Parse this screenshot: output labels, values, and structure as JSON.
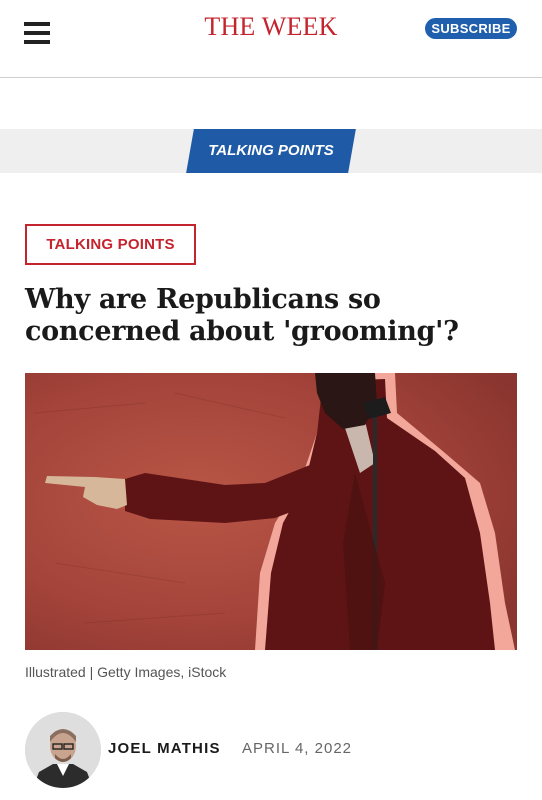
{
  "header": {
    "logo": "THE WEEK",
    "subscribe_label": "SUBSCRIBE",
    "menu_icon": "hamburger-menu-icon"
  },
  "section_banner": {
    "label": "TALKING POINTS"
  },
  "article": {
    "category_tag": "TALKING POINTS",
    "headline": "Why are Republicans so concerned about 'grooming'?",
    "image_caption": "Illustrated | Getty Images, iStock",
    "author": "JOEL MATHIS",
    "date": "APRIL 4, 2022"
  },
  "colors": {
    "brand_red": "#c4242d",
    "accent_blue": "#1e5aa6",
    "banner_gray": "#efefef"
  }
}
